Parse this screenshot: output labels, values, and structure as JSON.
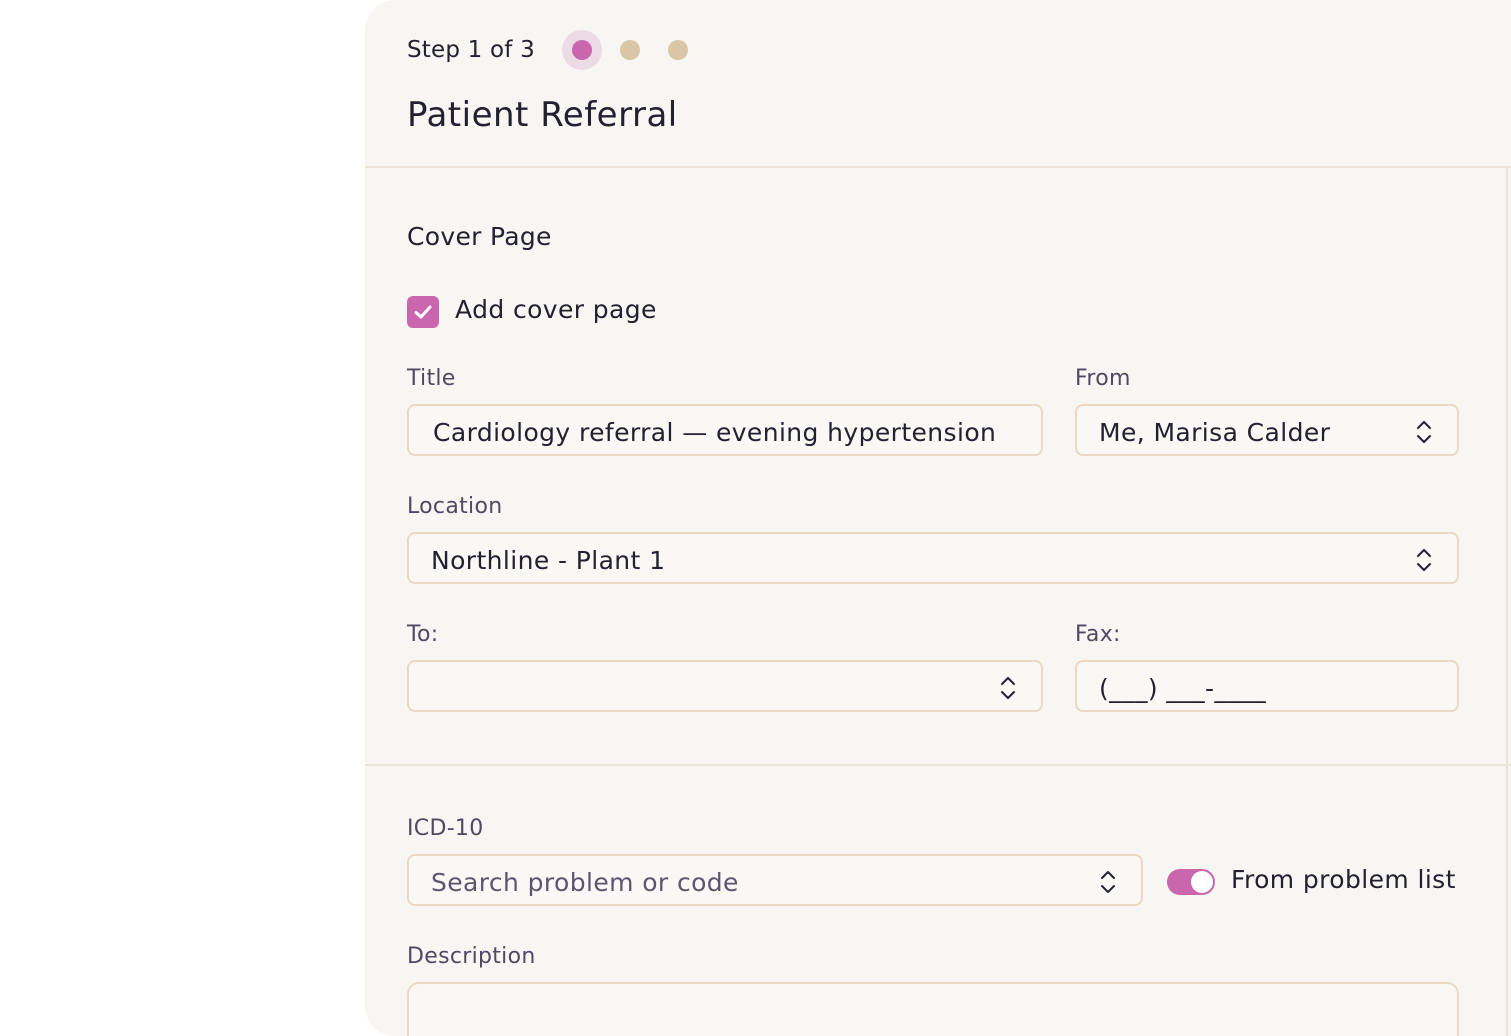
{
  "header": {
    "step_text": "Step 1 of 3",
    "total_steps": 3,
    "current_step": 1,
    "title": "Patient Referral"
  },
  "cover_page": {
    "section_title": "Cover Page",
    "add_cover_checkbox": {
      "label": "Add cover page",
      "checked": true
    },
    "title_field": {
      "label": "Title",
      "value": "Cardiology referral — evening hypertension"
    },
    "from_field": {
      "label": "From",
      "value": "Me, Marisa Calder"
    },
    "location_field": {
      "label": "Location",
      "value": "Northline - Plant 1"
    },
    "to_field": {
      "label": "To:",
      "value": ""
    },
    "fax_field": {
      "label": "Fax:",
      "value": "(___) ___-____"
    }
  },
  "diagnosis": {
    "icd_label": "ICD-10",
    "icd_placeholder": "Search problem or code",
    "problem_list_toggle": {
      "label": "From problem list",
      "on": true
    },
    "description_label": "Description",
    "description_value": ""
  },
  "colors": {
    "accent": "#c966ad",
    "inactive_dot": "#d8c6a7",
    "panel_bg": "#f8f6f2",
    "field_border": "#ead9c2"
  },
  "icons": {
    "checkbox": "check-icon",
    "select": "chevron-up-down-icon"
  }
}
